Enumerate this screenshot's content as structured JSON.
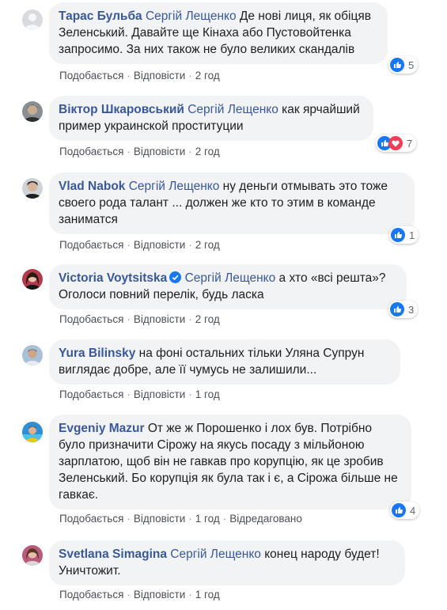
{
  "actions": {
    "like": "Подобається",
    "reply": "Відповісти",
    "edited": "Відредаговано",
    "sep": "·"
  },
  "comments": [
    {
      "author": "Тарас Бульба",
      "tag": "Сергій Лещенко",
      "text": " Де нові лиця, як обіцяв Зеленський. Давайте ще Кінаха або Пустовойтенка запросимо. За них також не було великих скандалів",
      "time": "2 год",
      "reactions": "5",
      "reaction_types": [
        "like"
      ]
    },
    {
      "author": "Віктор Шкаровський",
      "tag": "Сергій Лещенко",
      "text": " как ярчайший пример украинской проституции",
      "time": "2 год",
      "reactions": "7",
      "reaction_types": [
        "like",
        "love"
      ]
    },
    {
      "author": "Vlad Nabok",
      "tag": "Сергій Лещенко",
      "text": " ну деньги отмывать это тоже своего рода талант ... должен же кто то этим в команде заниматся",
      "time": "2 год",
      "reactions": "1",
      "reaction_types": [
        "like"
      ]
    },
    {
      "author": "Victoria Voytsitska",
      "tag": "Сергій Лещенко",
      "text": " а хто «всі решта»? Оголоси повний перелік, будь ласка",
      "time": "2 год",
      "reactions": "3",
      "reaction_types": [
        "like"
      ],
      "verified": true
    },
    {
      "author": "Yura Bilinsky",
      "tag": "",
      "text": " на фоні остальних тільки Уляна Супрун виглядає добре, але її чумусь не залишили...",
      "time": "1 год",
      "reactions": "",
      "reaction_types": []
    },
    {
      "author": "Evgeniy Mazur",
      "tag": "",
      "text": " От же ж Порошенко і лох був. Потрібно було призначити Сірожу на якусь посаду з мільйоною зарплатою, щоб він не гавкав про корупцію, як це зробив Зеленський. Бо корупція як була так і є, а Сірожа більше не гавкає.",
      "time": "1 год",
      "reactions": "4",
      "reaction_types": [
        "like"
      ],
      "edited": true
    },
    {
      "author": "Svetlana Simagina",
      "tag": "Сергій Лещенко",
      "text": " конец народу будет! Уничтожит.",
      "time": "1 год",
      "reactions": "",
      "reaction_types": []
    }
  ],
  "colors": {
    "link": "#385898",
    "bubble": "#f2f3f5",
    "meta": "#606770",
    "like": "#1877f2",
    "love": "#f33e58"
  }
}
